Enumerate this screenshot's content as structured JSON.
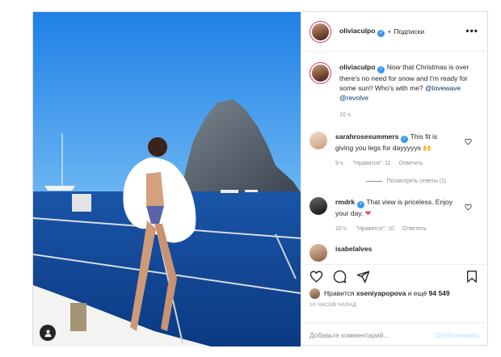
{
  "post": {
    "username": "oliviaculpo",
    "separator": "•",
    "follow_label": "Подписки",
    "more_label": "•••",
    "caption": {
      "username": "oliviaculpo",
      "text": "Now that Christmas is over there's no need for snow and I'm ready for some sun!! Who's with me?",
      "mention1": "@lovewave",
      "mention2": "@revolve",
      "time": "10 ч."
    },
    "comments": [
      {
        "username": "sarahrosesummers",
        "text": "This fit is giving you legs for dayyyyys",
        "time": "9 ч.",
        "likes": "\"Нравится\": 11",
        "reply": "Ответить",
        "view_replies": "Посмотреть ответы (1)"
      },
      {
        "username": "rmdrk",
        "text": "That view is priceless. Enjoy your day.",
        "time": "10 ч.",
        "likes": "\"Нравится\": 10",
        "reply": "Ответить"
      },
      {
        "username": "isabelalves"
      }
    ],
    "liked_by_prefix": "Нравится",
    "liked_by_user": "xseniyapopova",
    "liked_by_suffix": "и ещё",
    "likes_count": "94 549",
    "timestamp": "10 ЧАСОВ НАЗАД",
    "comment_placeholder": "Добавьте комментарий...",
    "publish_label": "Опубликовать"
  },
  "colors": {
    "accent": "#3897f0",
    "publish_disabled": "#b2dffc",
    "like_heart": "#ed4956"
  },
  "icons": [
    "tag-user-icon",
    "verified-icon",
    "more-icon",
    "heart-icon",
    "comment-icon",
    "share-icon",
    "bookmark-icon",
    "heart-small-icon",
    "heart-emoji-icon"
  ]
}
